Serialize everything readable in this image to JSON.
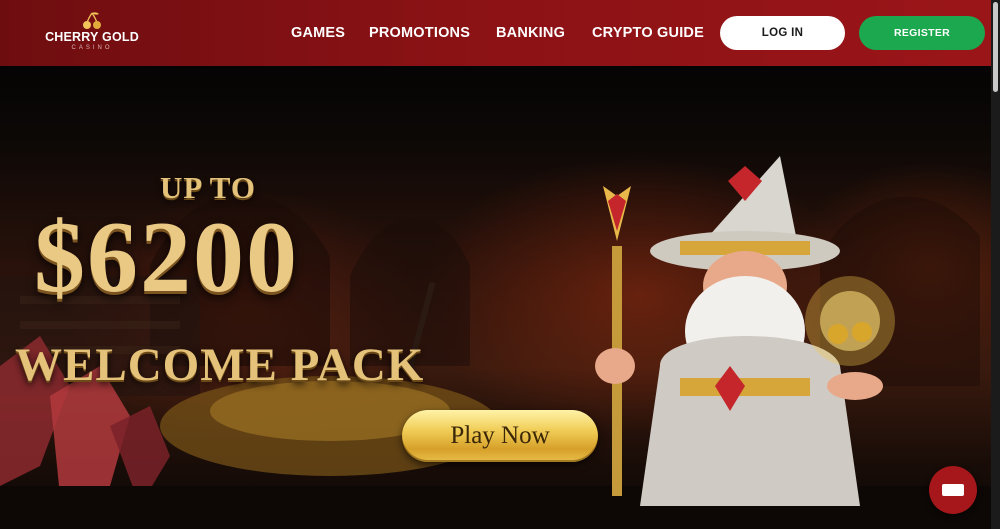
{
  "header": {
    "logo": {
      "name": "CHERRY GOLD",
      "sub": "CASINO"
    },
    "nav": [
      {
        "label": "GAMES"
      },
      {
        "label": "PROMOTIONS"
      },
      {
        "label": "BANKING"
      },
      {
        "label": "CRYPTO GUIDE"
      }
    ],
    "login_label": "LOG IN",
    "register_label": "REGISTER"
  },
  "hero": {
    "promo_line1": "UP TO",
    "promo_amount": "$6200",
    "promo_line3": "WELCOME PACK",
    "cta_label": "Play Now"
  },
  "colors": {
    "header_bg": "#8a1215",
    "register_green": "#1ca84f",
    "gold": "#e5c27a",
    "chat_red": "#a5171a"
  },
  "icons": [
    "cherries-logo-icon",
    "chat-icon"
  ]
}
